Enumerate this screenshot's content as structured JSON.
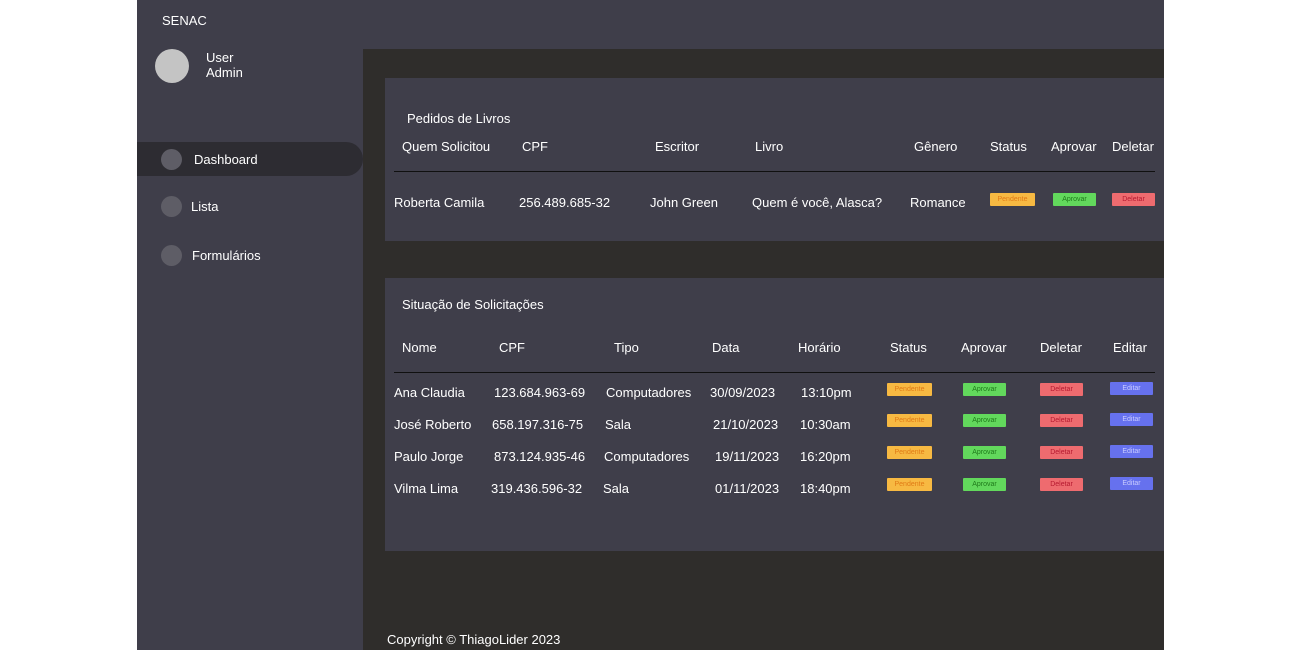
{
  "brand": "SENAC",
  "user": {
    "name": "User",
    "role": "Admin"
  },
  "nav": [
    {
      "label": "Dashboard"
    },
    {
      "label": "Lista"
    },
    {
      "label": "Formulários"
    }
  ],
  "pedidos": {
    "title": "Pedidos de Livros",
    "headers": [
      "Quem Solicitou",
      "CPF",
      "Escritor",
      "Livro",
      "Gênero",
      "Status",
      "Aprovar",
      "Deletar"
    ],
    "rows": [
      {
        "nome": "Roberta Camila",
        "cpf": "256.489.685-32",
        "escritor": "John Green",
        "livro": "Quem é você, Alasca?",
        "genero": "Romance",
        "status": "Pendente",
        "aprovar": "Aprovar",
        "deletar": "Deletar"
      }
    ]
  },
  "situacao": {
    "title": "Situação de Solicitações",
    "headers": [
      "Nome",
      "CPF",
      "Tipo",
      "Data",
      "Horário",
      "Status",
      "Aprovar",
      "Deletar",
      "Editar"
    ],
    "rows": [
      {
        "nome": "Ana Claudia",
        "cpf": "123.684.963-69",
        "tipo": "Computadores",
        "data": "30/09/2023",
        "horario": "13:10pm",
        "status": "Pendente",
        "aprovar": "Aprovar",
        "deletar": "Deletar",
        "editar": "Editar"
      },
      {
        "nome": "José Roberto",
        "cpf": "658.197.316-75",
        "tipo": "Sala",
        "data": "21/10/2023",
        "horario": "10:30am",
        "status": "Pendente",
        "aprovar": "Aprovar",
        "deletar": "Deletar",
        "editar": "Editar"
      },
      {
        "nome": "Paulo Jorge",
        "cpf": "873.124.935-46",
        "tipo": "Computadores",
        "data": "19/11/2023",
        "horario": "16:20pm",
        "status": "Pendente",
        "aprovar": "Aprovar",
        "deletar": "Deletar",
        "editar": "Editar"
      },
      {
        "nome": "Vilma Lima",
        "cpf": "319.436.596-32",
        "tipo": "Sala",
        "data": "01/11/2023",
        "horario": "18:40pm",
        "status": "Pendente",
        "aprovar": "Aprovar",
        "deletar": "Deletar",
        "editar": "Editar"
      }
    ]
  },
  "footer": "Copyright © ThiagoLider 2023"
}
